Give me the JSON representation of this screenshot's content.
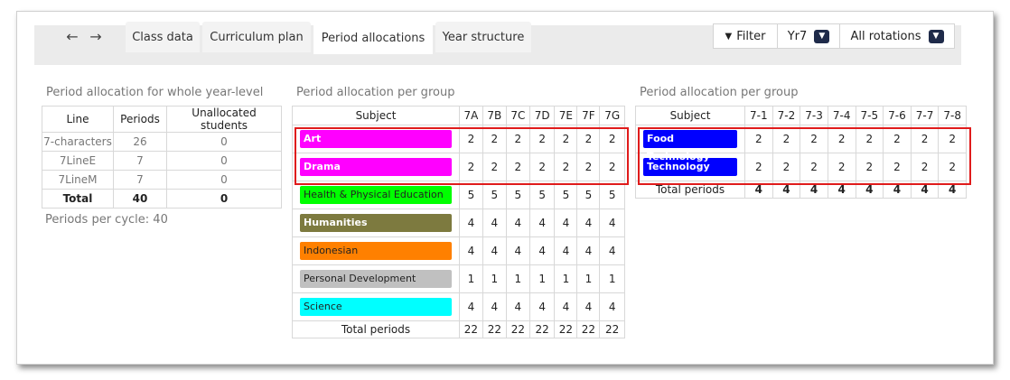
{
  "nav": {
    "back_icon": "arrow-left-icon",
    "forward_icon": "arrow-right-icon",
    "tabs": [
      {
        "label": "Class data"
      },
      {
        "label": "Curriculum plan"
      },
      {
        "label": "Period allocations",
        "active": true
      },
      {
        "label": "Year structure"
      }
    ],
    "filter_label": "Filter",
    "year_value": "Yr7",
    "rotation_value": "All rotations"
  },
  "year_level": {
    "title": "Period allocation for whole year-level",
    "headers": [
      "Line",
      "Periods",
      "Unallocated students"
    ],
    "rows": [
      [
        "7-characters",
        "26",
        "0"
      ],
      [
        "7LineE",
        "7",
        "0"
      ],
      [
        "7LineM",
        "7",
        "0"
      ]
    ],
    "total": [
      "Total",
      "40",
      "0"
    ],
    "periods_per_cycle_label": "Periods per cycle:",
    "periods_per_cycle_value": "40"
  },
  "group_a": {
    "title": "Period allocation per group",
    "headers": [
      "Subject",
      "7A",
      "7B",
      "7C",
      "7D",
      "7E",
      "7F",
      "7G"
    ],
    "rows": [
      {
        "subject": "Art",
        "color": "#ff00ff",
        "text_color": "#ffffff",
        "values": [
          "2",
          "2",
          "2",
          "2",
          "2",
          "2",
          "2"
        ]
      },
      {
        "subject": "Drama",
        "color": "#ff00ff",
        "text_color": "#ffffff",
        "values": [
          "2",
          "2",
          "2",
          "2",
          "2",
          "2",
          "2"
        ]
      },
      {
        "subject": "Health & Physical Education",
        "color": "#00ff00",
        "text_color": "#222222",
        "values": [
          "5",
          "5",
          "5",
          "5",
          "5",
          "5",
          "5"
        ]
      },
      {
        "subject": "Humanities",
        "color": "#7d7a3f",
        "text_color": "#ffffff",
        "values": [
          "4",
          "4",
          "4",
          "4",
          "4",
          "4",
          "4"
        ]
      },
      {
        "subject": "Indonesian",
        "color": "#ff8000",
        "text_color": "#222222",
        "values": [
          "4",
          "4",
          "4",
          "4",
          "4",
          "4",
          "4"
        ]
      },
      {
        "subject": "Personal Development",
        "color": "#c0c0c0",
        "text_color": "#222222",
        "values": [
          "1",
          "1",
          "1",
          "1",
          "1",
          "1",
          "1"
        ]
      },
      {
        "subject": "Science",
        "color": "#00ffff",
        "text_color": "#222222",
        "values": [
          "4",
          "4",
          "4",
          "4",
          "4",
          "4",
          "4"
        ]
      }
    ],
    "total_label": "Total periods",
    "totals": [
      "22",
      "22",
      "22",
      "22",
      "22",
      "22",
      "22"
    ]
  },
  "group_b": {
    "title": "Period allocation per group",
    "headers": [
      "Subject",
      "7-1",
      "7-2",
      "7-3",
      "7-4",
      "7-5",
      "7-6",
      "7-7",
      "7-8"
    ],
    "rows": [
      {
        "subject": "Food Technology",
        "color": "#0000ff",
        "text_color": "#ffffff",
        "values": [
          "2",
          "2",
          "2",
          "2",
          "2",
          "2",
          "2",
          "2"
        ]
      },
      {
        "subject": "Technology",
        "color": "#0000ff",
        "text_color": "#ffffff",
        "values": [
          "2",
          "2",
          "2",
          "2",
          "2",
          "2",
          "2",
          "2"
        ]
      }
    ],
    "total_label": "Total periods",
    "totals": [
      "4",
      "4",
      "4",
      "4",
      "4",
      "4",
      "4",
      "4"
    ]
  },
  "highlight_color": "#e01b1b"
}
